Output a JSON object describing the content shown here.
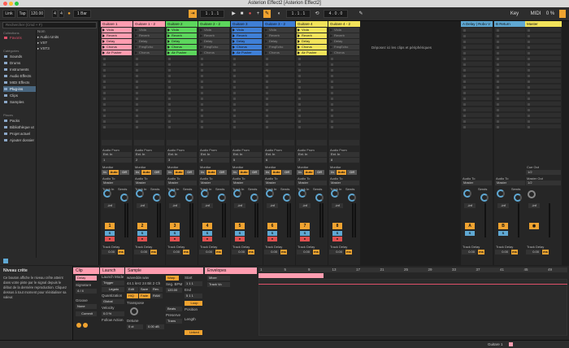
{
  "window": {
    "title": "Asterion Effect2  [Asterion Effect2]"
  },
  "transport": {
    "link": "Link",
    "tap": "Tap",
    "tempo": "120.00",
    "sig_num": "4",
    "sig_den": "4",
    "loop_mode": "1 Bar",
    "position": "1 . 1 . 1",
    "loop_start": "1 . 1 . 1",
    "loop_len": "4 . 0 . 0",
    "key": "Key",
    "midi": "MIDI",
    "cpu": "0 %"
  },
  "browser": {
    "search_placeholder": "Rechercher (Cmd + F)",
    "collections_label": "Collections",
    "collections": [
      "Favoris"
    ],
    "categories_label": "Catégories",
    "categories": [
      "Sounds",
      "Drums",
      "Instruments",
      "Audio Effects",
      "MIDI Effects",
      "Plug-ins",
      "Clips",
      "Samples"
    ],
    "selected_index": 5,
    "places_label": "Places",
    "places": [
      "Packs",
      "Bibliothèque ut",
      "Projet actuel",
      "Ajouter dossier"
    ],
    "list_header": "Nom",
    "list": [
      "Audio Units",
      "VST",
      "VST3"
    ]
  },
  "tracks": [
    {
      "name": "Guitare 1",
      "color": "#ff9db0",
      "clips": [
        "Viola",
        "Reverb",
        "Delay",
        "Chorus",
        "Air Pusher"
      ],
      "clip_active": true,
      "num": "1",
      "audio_from": "Ext. In",
      "audio_from_ch": "1",
      "audio_to": "Master",
      "vol": "-inf"
    },
    {
      "name": "Guitare 1 - 2",
      "color": "#ff9db0",
      "clips": [
        "Viola",
        "Reverb",
        "Delay",
        "FreqEcho",
        "Chorus"
      ],
      "clip_active": false,
      "num": "2",
      "audio_from": "Ext. In",
      "audio_from_ch": "2",
      "audio_to": "Master",
      "vol": "-inf"
    },
    {
      "name": "Guitare 2",
      "color": "#5cd65c",
      "clips": [
        "Viola",
        "Reverb",
        "Delay",
        "Chorus",
        "Air Pusher"
      ],
      "clip_active": true,
      "num": "3",
      "audio_from": "Ext. In",
      "audio_from_ch": "3",
      "audio_to": "Master",
      "vol": "-inf"
    },
    {
      "name": "Guitare 2 - 2",
      "color": "#5cd65c",
      "clips": [
        "Viola",
        "Reverb",
        "Delay",
        "FreqEcho",
        "Chorus"
      ],
      "clip_active": false,
      "num": "4",
      "audio_from": "Ext. In",
      "audio_from_ch": "4",
      "audio_to": "Master",
      "vol": "-inf"
    },
    {
      "name": "Guitare 3",
      "color": "#3f7fd6",
      "clips": [
        "Viola",
        "Reverb",
        "Delay",
        "Chorus",
        "Air Pusher"
      ],
      "clip_active": true,
      "num": "5",
      "audio_from": "Ext. In",
      "audio_from_ch": "5",
      "audio_to": "Master",
      "vol": "-inf"
    },
    {
      "name": "Guitare 3 - 2",
      "color": "#3f7fd6",
      "clips": [
        "Viola",
        "Reverb",
        "Delay",
        "FreqEcho",
        "Chorus"
      ],
      "clip_active": false,
      "num": "6",
      "audio_from": "Ext. In",
      "audio_from_ch": "6",
      "audio_to": "Master",
      "vol": "-inf"
    },
    {
      "name": "Guitare 4",
      "color": "#f2e35a",
      "clips": [
        "Viola",
        "Reverb",
        "Delay",
        "Chorus",
        "Air Pusher"
      ],
      "clip_active": true,
      "num": "7",
      "audio_from": "Ext. In",
      "audio_from_ch": "7",
      "audio_to": "Master",
      "vol": "-inf"
    },
    {
      "name": "Guitare 4 - 2",
      "color": "#f2e35a",
      "clips": [
        "Viola",
        "Reverb",
        "Delay",
        "FreqEcho",
        "Chorus"
      ],
      "clip_active": false,
      "num": "8",
      "audio_from": "Ext. In",
      "audio_from_ch": "8",
      "audio_to": "Master",
      "vol": "-inf"
    }
  ],
  "drop_hint": "Déposez ici les clips et périphériques",
  "returns": [
    {
      "name": "A Delay | Robo V",
      "letter": "A",
      "audio_to": "Master",
      "vol": "-inf"
    },
    {
      "name": "B Return",
      "letter": "B",
      "audio_to": "Master",
      "vol": "-inf"
    }
  ],
  "master": {
    "name": "Master",
    "cue_out": "Cue Out",
    "cue_val": "1/2",
    "master_out": "Master Out",
    "master_val": "1/2",
    "vol": "-inf"
  },
  "labels": {
    "audio_from": "Audio From",
    "monitor": "Monitor",
    "audio_to": "Audio To",
    "track_in": "Track In",
    "sends": "Sends",
    "in": "In",
    "auto": "Auto",
    "off": "Off",
    "track_delay": "Track Delay",
    "ms": "ms",
    "delay_val": "0.00"
  },
  "info_view": {
    "title": "Niveau crête",
    "text": "Ce bouton affiche le niveau crête atteint dans votre piste par le signal depuis le début de la dernière reproduction. Cliquez dessus à tout moment pour réinitialiser sa valeur."
  },
  "clip_view": {
    "clip_tab": "Clip",
    "clip_name": "Delay",
    "signature_label": "Signature",
    "sig": "4 / 4",
    "groove_label": "Groove",
    "groove_val": "None",
    "commit": "Commit",
    "launch_tab": "Launch",
    "launch_mode_label": "Launch Mode",
    "launch_mode": "Trigger",
    "legato": "Legato",
    "quant_label": "Quantization",
    "quant": "Global",
    "vel_label": "Velocity",
    "vel": "0.0 %",
    "follow_label": "Follow Action",
    "sample_tab": "Sample",
    "sample_file": "wavedde.wav",
    "sample_info": "44.1 kHz 24 Bit 2 Ch",
    "edit": "Edit",
    "save": "Save",
    "rev": "Rev.",
    "hiq": "HiQ",
    "fade": "Fade",
    "ram": "RAM",
    "transpose_label": "Transpose",
    "detune_label": "Detune",
    "detune": "0 ct",
    "gain": "0.00 dB",
    "warp": "Warp",
    "seg_bpm_label": "Seg. BPM",
    "seg_bpm": "120.00",
    "beats": "Beats",
    "preserve": "Preserve",
    "trans": "Trans",
    "start_label": "Start",
    "end_label": "End",
    "loop_label": "Loop",
    "position_label": "Position",
    "length_label": "Length",
    "start": "1  1  1",
    "end": "5  1  1",
    "loop_btn": "Loop",
    "linked": "Linked",
    "env_tab": "Envelopes",
    "env_device": "Mixer",
    "env_param": "Track Vo",
    "ruler": [
      "1",
      "5",
      "9",
      "13",
      "17",
      "21",
      "25",
      "29",
      "33",
      "37",
      "41",
      "45",
      "49"
    ]
  },
  "status": {
    "track_name": "Guitare 1"
  }
}
